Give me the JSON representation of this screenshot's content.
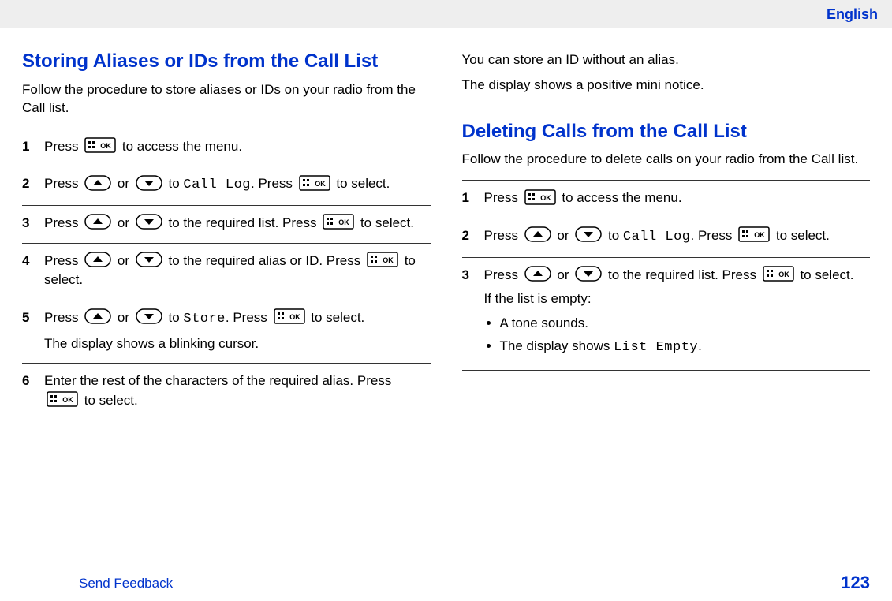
{
  "language": "English",
  "section1": {
    "title": "Storing Aliases or IDs from the Call List",
    "intro": "Follow the procedure to store aliases or IDs on your radio from the Call list.",
    "steps": [
      {
        "num": "1",
        "parts": [
          "Press {OK} to access the menu."
        ]
      },
      {
        "num": "2",
        "parts": [
          "Press {UP} or {DOWN} to ",
          {
            "mono": "Call Log"
          },
          ". Press {OK} to select."
        ]
      },
      {
        "num": "3",
        "parts": [
          "Press {UP} or {DOWN} to the required list. Press {OK} to select."
        ]
      },
      {
        "num": "4",
        "parts": [
          "Press {UP} or {DOWN} to the required alias or ID. Press {OK} to select."
        ]
      },
      {
        "num": "5",
        "parts": [
          "Press {UP} or {DOWN} to ",
          {
            "mono": "Store"
          },
          ". Press {OK} to select."
        ],
        "after": "The display shows a blinking cursor."
      },
      {
        "num": "6",
        "parts": [
          "Enter the rest of the characters of the required alias. Press {OK} to select."
        ]
      }
    ],
    "notes": [
      "You can store an ID without an alias.",
      "The display shows a positive mini notice."
    ]
  },
  "section2": {
    "title": "Deleting Calls from the Call List",
    "intro": "Follow the procedure to delete calls on your radio from the Call list.",
    "steps": [
      {
        "num": "1",
        "parts": [
          "Press {OK} to access the menu."
        ]
      },
      {
        "num": "2",
        "parts": [
          "Press {UP} or {DOWN} to ",
          {
            "mono": "Call Log"
          },
          ". Press {OK} to select."
        ]
      },
      {
        "num": "3",
        "parts": [
          "Press {UP} or {DOWN} to the required list. Press {OK} to select."
        ],
        "after": "If the list is empty:",
        "bullets": [
          "A tone sounds.",
          {
            "pre": "The display shows ",
            "mono": "List Empty",
            "post": "."
          }
        ]
      }
    ]
  },
  "footer": {
    "link": "Send Feedback",
    "page": "123"
  }
}
